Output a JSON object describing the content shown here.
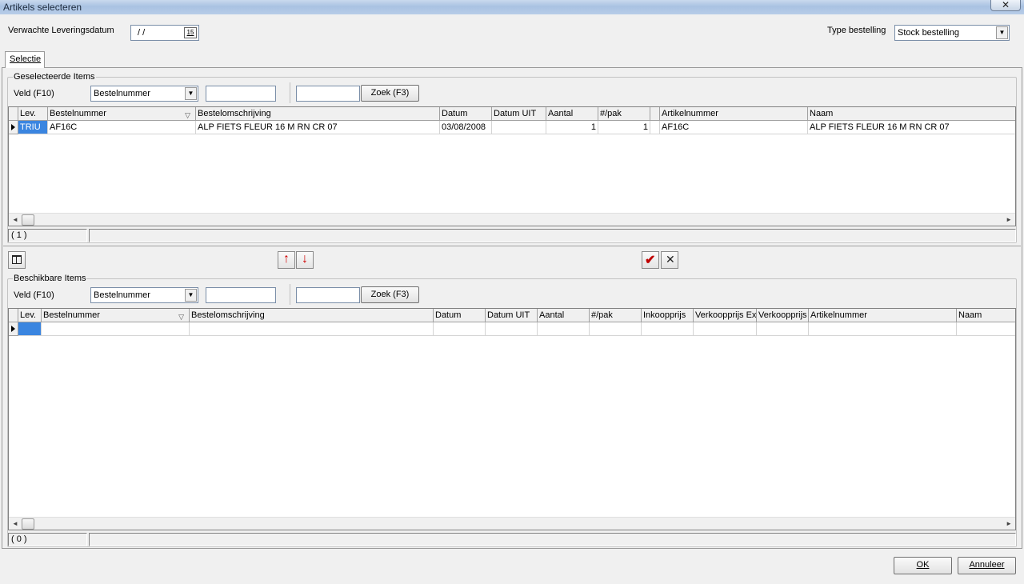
{
  "window": {
    "title": "Artikels selecteren"
  },
  "header": {
    "delivery_label": "Verwachte Leveringsdatum",
    "delivery_value": "/ /",
    "calendar_glyph": "15",
    "order_type_label": "Type bestelling",
    "order_type_value": "Stock bestelling"
  },
  "tabs": [
    {
      "label": "Selectie"
    }
  ],
  "selected": {
    "title": "Geselecteerde Items",
    "field_label": "Veld (F10)",
    "field_value": "Bestelnummer",
    "search_button": "Zoek (F3)",
    "columns": [
      "Lev.",
      "Bestelnummer",
      "Bestelomschrijving",
      "Datum",
      "Datum UIT",
      "Aantal",
      "#/pak",
      "Artikelnummer",
      "Naam"
    ],
    "rows": [
      {
        "lev": "TRIU",
        "bestelnummer": "AF16C",
        "omschrijving": "ALP FIETS FLEUR 16 M RN CR 07",
        "datum": "03/08/2008",
        "datum_uit": "",
        "aantal": "1",
        "pak": "1",
        "artikelnummer": "AF16C",
        "naam": "ALP FIETS FLEUR 16 M RN CR 07"
      }
    ],
    "count": "( 1 )"
  },
  "available": {
    "title": "Beschikbare Items",
    "field_label": "Veld (F10)",
    "field_value": "Bestelnummer",
    "search_button": "Zoek (F3)",
    "columns": [
      "Lev.",
      "Bestelnummer",
      "Bestelomschrijving",
      "Datum",
      "Datum UIT",
      "Aantal",
      "#/pak",
      "Inkoopprijs",
      "Verkoopprijs Ex",
      "Verkoopprijs",
      "Artikelnummer",
      "Naam"
    ],
    "count": "( 0 )"
  },
  "icons": {
    "columns": "columns-icon",
    "move_up": "arrow-up-icon",
    "move_down": "arrow-down-icon",
    "accept": "checkmark-icon",
    "reject": "cross-icon"
  },
  "colors": {
    "selection": "#3a85e0",
    "arrow_red": "#d00000",
    "check_red": "#c00000"
  },
  "footer": {
    "ok": "OK",
    "cancel": "Annuleer"
  }
}
